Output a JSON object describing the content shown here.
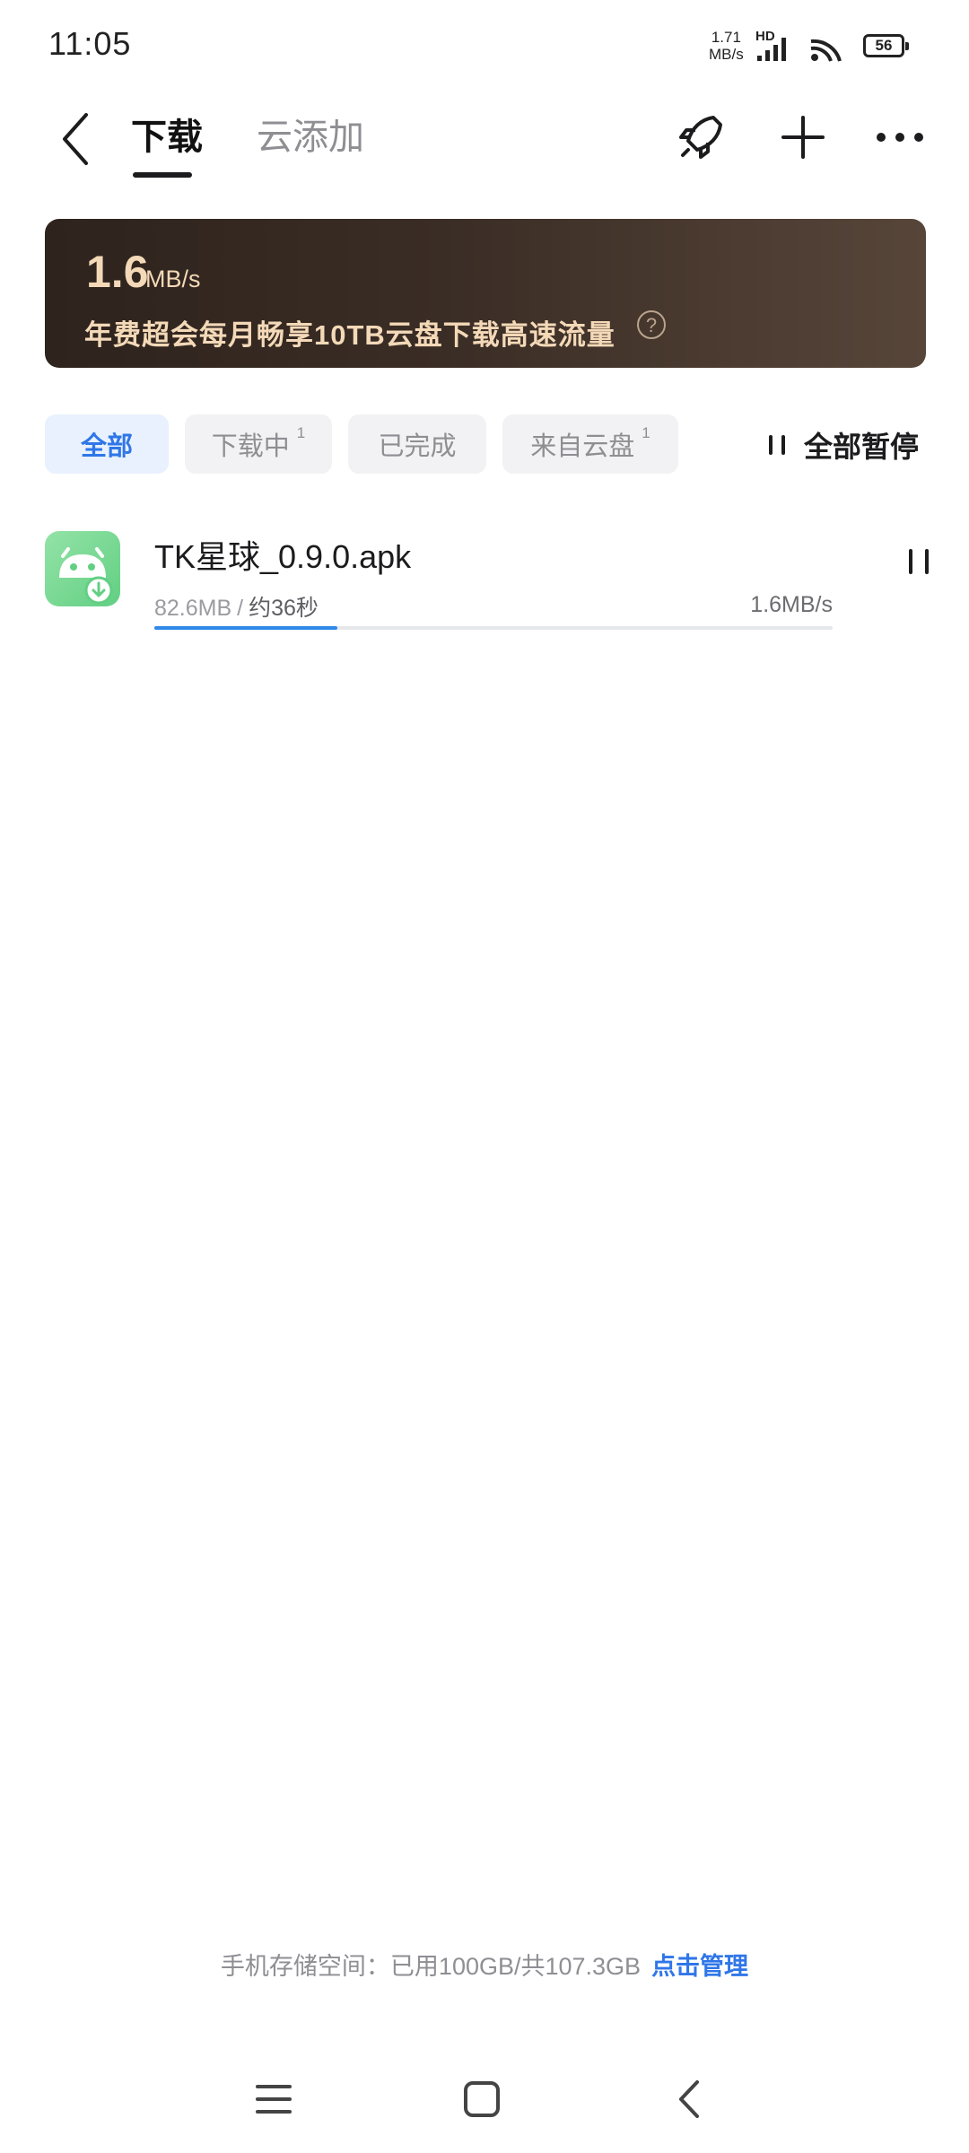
{
  "status_bar": {
    "time": "11:05",
    "net_speed_value": "1.71",
    "net_speed_unit": "MB/s",
    "hd": "HD",
    "battery": "56"
  },
  "header": {
    "tabs": [
      {
        "label": "下载",
        "active": true
      },
      {
        "label": "云添加",
        "active": false
      }
    ]
  },
  "promo": {
    "speed_value": "1.6",
    "speed_unit": "MB/s",
    "text": "年费超会每月畅享10TB云盘下载高速流量",
    "help_icon": "?"
  },
  "filters": {
    "chips": [
      {
        "label": "全部",
        "badge": "",
        "active": true
      },
      {
        "label": "下载中",
        "badge": "1",
        "active": false
      },
      {
        "label": "已完成",
        "badge": "",
        "active": false
      },
      {
        "label": "来自云盘",
        "badge": "1",
        "active": false
      }
    ],
    "pause_all_label": "全部暂停"
  },
  "downloads": [
    {
      "name": "TK星球_0.9.0.apk",
      "size": "82.6MB",
      "separator": "/",
      "eta": "约36秒",
      "speed": "1.6MB/s",
      "progress": 0.27,
      "icon": "android-apk-download-icon"
    }
  ],
  "storage": {
    "text": "手机存储空间：已用100GB/共107.3GB",
    "manage_label": "点击管理"
  },
  "colors": {
    "accent": "#2f76e8",
    "promo_text": "#f4d9b8",
    "app_icon": "#62cf83"
  }
}
